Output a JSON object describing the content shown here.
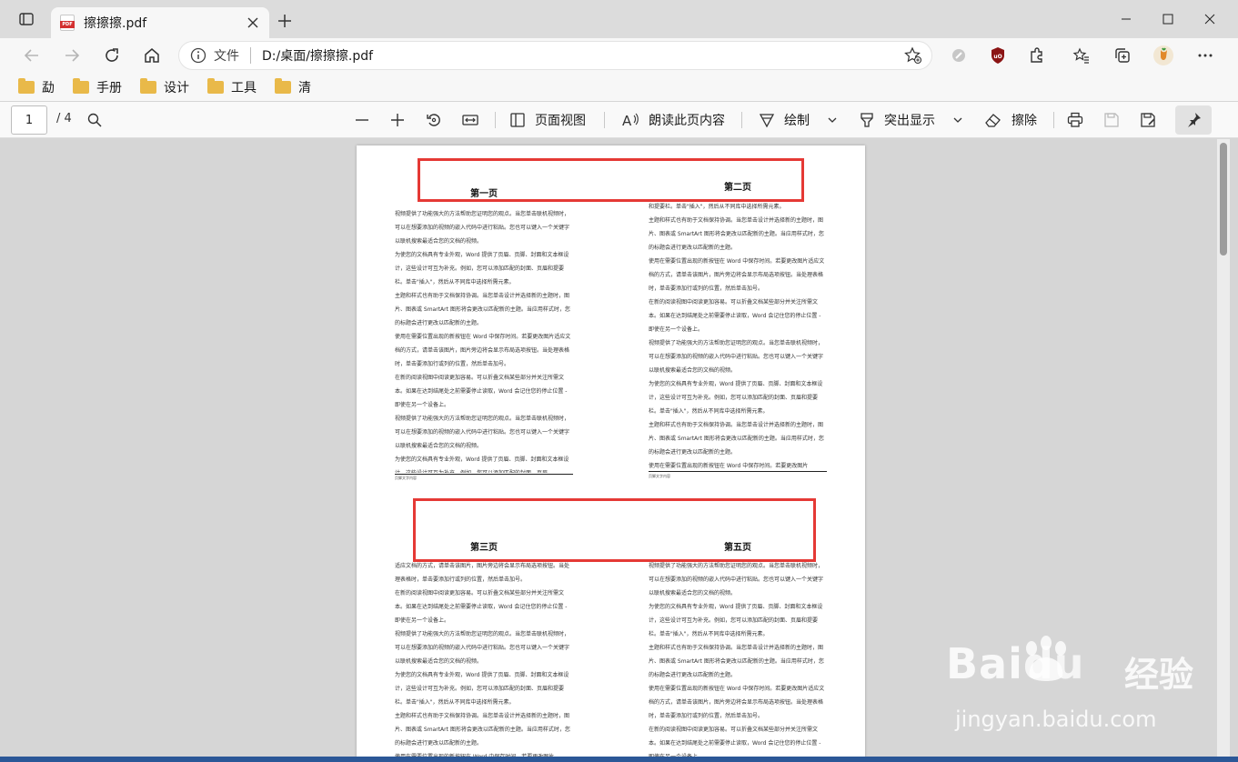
{
  "browser": {
    "tab": {
      "title": "擦擦擦.pdf"
    },
    "address": {
      "scheme_label": "文件",
      "url": "D:/桌面/擦擦擦.pdf"
    },
    "bookmarks": [
      {
        "label": "勐"
      },
      {
        "label": "手册"
      },
      {
        "label": "设计"
      },
      {
        "label": "工具"
      },
      {
        "label": "清"
      }
    ]
  },
  "pdf_toolbar": {
    "page_current": "1",
    "page_total": "/ 4",
    "page_view_label": "页面视图",
    "read_aloud_label": "朗读此页内容",
    "draw_label": "绘制",
    "highlight_label": "突出显示",
    "erase_label": "擦除"
  },
  "document": {
    "pages": [
      {
        "title": "第一页",
        "body": "视频提供了功能强大的方法帮助您证明您的观点。当您单击联机视频时，可以在想要添加的视频的嵌入代码中进行粘贴。您也可以键入一个关键字以联机搜索最适合您的文档的视频。\n为使您的文档具有专业外观，Word 提供了页眉、页脚、封面和文本框设计，这些设计可互为补充。例如，您可以添加匹配的封面、页眉和提要栏。单击\"插入\"，然后从不同库中选择所需元素。\n主题和样式也有助于文档保持协调。当您单击设计并选择新的主题时，图片、图表或 SmartArt 图形将会更改以匹配新的主题。当应用样式时，您的标题会进行更改以匹配新的主题。\n使用在需要位置出现的新按钮在 Word 中保存时间。若要更改图片适应文档的方式，请单击该图片，图片旁边将会显示布局选项按钮。当处理表格时，单击要添加行或列的位置，然后单击加号。\n在新的阅读视图中阅读更加容易。可以折叠文档某些部分并关注所需文本。如果在达到结尾处之前需要停止读取，Word 会记住您的停止位置 - 即使在另一个设备上。\n视频提供了功能强大的方法帮助您证明您的观点。当您单击联机视频时，可以在想要添加的视频的嵌入代码中进行粘贴。您也可以键入一个关键字以联机搜索最适合您的文档的视频。\n为使您的文档具有专业外观，Word 提供了页眉、页脚、封面和文本框设计，这些设计可互为补充。例如，您可以添加匹配的封面、页眉",
        "footer": "页脚文字内容"
      },
      {
        "title": "第二页",
        "body": "和提要栏。单击\"插入\"，然后从不同库中选择所需元素。\n主题和样式也有助于文档保持协调。当您单击设计并选择新的主题时，图片、图表或 SmartArt 图形将会更改以匹配新的主题。当应用样式时，您的标题会进行更改以匹配新的主题。\n使用在需要位置出现的新按钮在 Word 中保存时间。若要更改图片适应文档的方式，请单击该图片，图片旁边将会显示布局选项按钮。当处理表格时，单击要添加行或列的位置，然后单击加号。\n在新的阅读视图中阅读更加容易。可以折叠文档某些部分并关注所需文本。如果在达到结尾处之前需要停止读取，Word 会记住您的停止位置 - 即使在另一个设备上。\n视频提供了功能强大的方法帮助您证明您的观点。当您单击联机视频时，可以在想要添加的视频的嵌入代码中进行粘贴。您也可以键入一个关键字以联机搜索最适合您的文档的视频。\n为使您的文档具有专业外观，Word 提供了页眉、页脚、封面和文本框设计，这些设计可互为补充。例如，您可以添加匹配的封面、页眉和提要栏。单击\"插入\"，然后从不同库中选择所需元素。\n主题和样式也有助于文档保持协调。当您单击设计并选择新的主题时，图片、图表或 SmartArt 图形将会更改以匹配新的主题。当应用样式时，您的标题会进行更改以匹配新的主题。\n使用在需要位置出现的新按钮在 Word 中保存时间。若要更改图片",
        "footer": "页脚文字内容"
      },
      {
        "title": "第三页",
        "body": "适应文档的方式，请单击该图片，图片旁边将会显示布局选项按钮。当处理表格时，单击要添加行或列的位置，然后单击加号。\n在新的阅读视图中阅读更加容易。可以折叠文档某些部分并关注所需文本。如果在达到结尾处之前需要停止读取，Word 会记住您的停止位置 - 即使在另一个设备上。\n视频提供了功能强大的方法帮助您证明您的观点。当您单击联机视频时，可以在想要添加的视频的嵌入代码中进行粘贴。您也可以键入一个关键字以联机搜索最适合您的文档的视频。\n为使您的文档具有专业外观，Word 提供了页眉、页脚、封面和文本框设计，这些设计可互为补充。例如，您可以添加匹配的封面、页眉和提要栏。单击\"插入\"，然后从不同库中选择所需元素。\n主题和样式也有助于文档保持协调。当您单击设计并选择新的主题时，图片、图表或 SmartArt 图形将会更改以匹配新的主题。当应用样式时，您的标题会进行更改以匹配新的主题。\n使用在需要位置出现的新按钮在 Word 中保存时间。若要更改图片"
      },
      {
        "title": "第五页",
        "body": "视频提供了功能强大的方法帮助您证明您的观点。当您单击联机视频时，可以在想要添加的视频的嵌入代码中进行粘贴。您也可以键入一个关键字以联机搜索最适合您的文档的视频。\n为使您的文档具有专业外观，Word 提供了页眉、页脚、封面和文本框设计，这些设计可互为补充。例如，您可以添加匹配的封面、页眉和提要栏。单击\"插入\"，然后从不同库中选择所需元素。\n主题和样式也有助于文档保持协调。当您单击设计并选择新的主题时，图片、图表或 SmartArt 图形将会更改以匹配新的主题。当应用样式时，您的标题会进行更改以匹配新的主题。\n使用在需要位置出现的新按钮在 Word 中保存时间。若要更改图片适应文档的方式，请单击该图片，图片旁边将会显示布局选项按钮。当处理表格时，单击要添加行或列的位置，然后单击加号。\n在新的阅读视图中阅读更加容易。可以折叠文档某些部分并关注所需文本。如果在达到结尾处之前需要停止读取，Word 会记住您的停止位置 - 即使在另一个设备上。"
      }
    ]
  },
  "watermark": {
    "brand": "Bai",
    "brand2": "du",
    "cn": "经验",
    "site": "jingyan.baidu.com"
  },
  "colors": {
    "annotation_red": "#e53935",
    "folder": "#e9b949",
    "pdf_red": "#d32f2f"
  }
}
